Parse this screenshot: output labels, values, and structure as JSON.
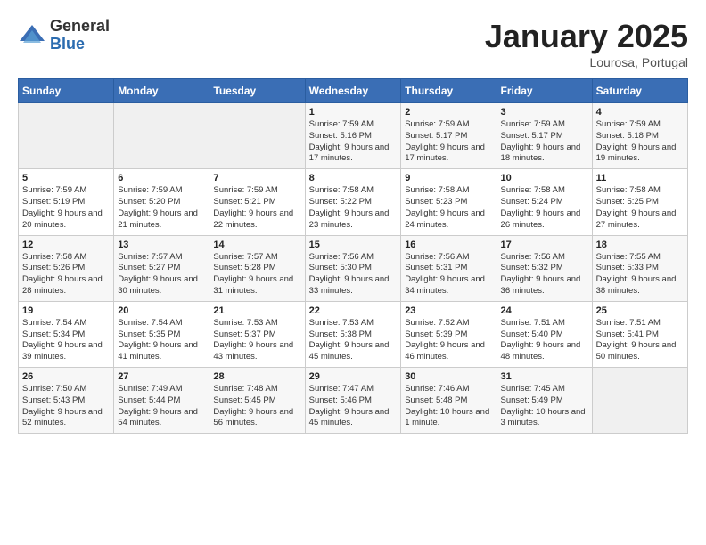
{
  "logo": {
    "general": "General",
    "blue": "Blue"
  },
  "header": {
    "month": "January 2025",
    "location": "Lourosa, Portugal"
  },
  "weekdays": [
    "Sunday",
    "Monday",
    "Tuesday",
    "Wednesday",
    "Thursday",
    "Friday",
    "Saturday"
  ],
  "weeks": [
    [
      {
        "day": "",
        "sunrise": "",
        "sunset": "",
        "daylight": ""
      },
      {
        "day": "",
        "sunrise": "",
        "sunset": "",
        "daylight": ""
      },
      {
        "day": "",
        "sunrise": "",
        "sunset": "",
        "daylight": ""
      },
      {
        "day": "1",
        "sunrise": "Sunrise: 7:59 AM",
        "sunset": "Sunset: 5:16 PM",
        "daylight": "Daylight: 9 hours and 17 minutes."
      },
      {
        "day": "2",
        "sunrise": "Sunrise: 7:59 AM",
        "sunset": "Sunset: 5:17 PM",
        "daylight": "Daylight: 9 hours and 17 minutes."
      },
      {
        "day": "3",
        "sunrise": "Sunrise: 7:59 AM",
        "sunset": "Sunset: 5:17 PM",
        "daylight": "Daylight: 9 hours and 18 minutes."
      },
      {
        "day": "4",
        "sunrise": "Sunrise: 7:59 AM",
        "sunset": "Sunset: 5:18 PM",
        "daylight": "Daylight: 9 hours and 19 minutes."
      }
    ],
    [
      {
        "day": "5",
        "sunrise": "Sunrise: 7:59 AM",
        "sunset": "Sunset: 5:19 PM",
        "daylight": "Daylight: 9 hours and 20 minutes."
      },
      {
        "day": "6",
        "sunrise": "Sunrise: 7:59 AM",
        "sunset": "Sunset: 5:20 PM",
        "daylight": "Daylight: 9 hours and 21 minutes."
      },
      {
        "day": "7",
        "sunrise": "Sunrise: 7:59 AM",
        "sunset": "Sunset: 5:21 PM",
        "daylight": "Daylight: 9 hours and 22 minutes."
      },
      {
        "day": "8",
        "sunrise": "Sunrise: 7:58 AM",
        "sunset": "Sunset: 5:22 PM",
        "daylight": "Daylight: 9 hours and 23 minutes."
      },
      {
        "day": "9",
        "sunrise": "Sunrise: 7:58 AM",
        "sunset": "Sunset: 5:23 PM",
        "daylight": "Daylight: 9 hours and 24 minutes."
      },
      {
        "day": "10",
        "sunrise": "Sunrise: 7:58 AM",
        "sunset": "Sunset: 5:24 PM",
        "daylight": "Daylight: 9 hours and 26 minutes."
      },
      {
        "day": "11",
        "sunrise": "Sunrise: 7:58 AM",
        "sunset": "Sunset: 5:25 PM",
        "daylight": "Daylight: 9 hours and 27 minutes."
      }
    ],
    [
      {
        "day": "12",
        "sunrise": "Sunrise: 7:58 AM",
        "sunset": "Sunset: 5:26 PM",
        "daylight": "Daylight: 9 hours and 28 minutes."
      },
      {
        "day": "13",
        "sunrise": "Sunrise: 7:57 AM",
        "sunset": "Sunset: 5:27 PM",
        "daylight": "Daylight: 9 hours and 30 minutes."
      },
      {
        "day": "14",
        "sunrise": "Sunrise: 7:57 AM",
        "sunset": "Sunset: 5:28 PM",
        "daylight": "Daylight: 9 hours and 31 minutes."
      },
      {
        "day": "15",
        "sunrise": "Sunrise: 7:56 AM",
        "sunset": "Sunset: 5:30 PM",
        "daylight": "Daylight: 9 hours and 33 minutes."
      },
      {
        "day": "16",
        "sunrise": "Sunrise: 7:56 AM",
        "sunset": "Sunset: 5:31 PM",
        "daylight": "Daylight: 9 hours and 34 minutes."
      },
      {
        "day": "17",
        "sunrise": "Sunrise: 7:56 AM",
        "sunset": "Sunset: 5:32 PM",
        "daylight": "Daylight: 9 hours and 36 minutes."
      },
      {
        "day": "18",
        "sunrise": "Sunrise: 7:55 AM",
        "sunset": "Sunset: 5:33 PM",
        "daylight": "Daylight: 9 hours and 38 minutes."
      }
    ],
    [
      {
        "day": "19",
        "sunrise": "Sunrise: 7:54 AM",
        "sunset": "Sunset: 5:34 PM",
        "daylight": "Daylight: 9 hours and 39 minutes."
      },
      {
        "day": "20",
        "sunrise": "Sunrise: 7:54 AM",
        "sunset": "Sunset: 5:35 PM",
        "daylight": "Daylight: 9 hours and 41 minutes."
      },
      {
        "day": "21",
        "sunrise": "Sunrise: 7:53 AM",
        "sunset": "Sunset: 5:37 PM",
        "daylight": "Daylight: 9 hours and 43 minutes."
      },
      {
        "day": "22",
        "sunrise": "Sunrise: 7:53 AM",
        "sunset": "Sunset: 5:38 PM",
        "daylight": "Daylight: 9 hours and 45 minutes."
      },
      {
        "day": "23",
        "sunrise": "Sunrise: 7:52 AM",
        "sunset": "Sunset: 5:39 PM",
        "daylight": "Daylight: 9 hours and 46 minutes."
      },
      {
        "day": "24",
        "sunrise": "Sunrise: 7:51 AM",
        "sunset": "Sunset: 5:40 PM",
        "daylight": "Daylight: 9 hours and 48 minutes."
      },
      {
        "day": "25",
        "sunrise": "Sunrise: 7:51 AM",
        "sunset": "Sunset: 5:41 PM",
        "daylight": "Daylight: 9 hours and 50 minutes."
      }
    ],
    [
      {
        "day": "26",
        "sunrise": "Sunrise: 7:50 AM",
        "sunset": "Sunset: 5:43 PM",
        "daylight": "Daylight: 9 hours and 52 minutes."
      },
      {
        "day": "27",
        "sunrise": "Sunrise: 7:49 AM",
        "sunset": "Sunset: 5:44 PM",
        "daylight": "Daylight: 9 hours and 54 minutes."
      },
      {
        "day": "28",
        "sunrise": "Sunrise: 7:48 AM",
        "sunset": "Sunset: 5:45 PM",
        "daylight": "Daylight: 9 hours and 56 minutes."
      },
      {
        "day": "29",
        "sunrise": "Sunrise: 7:47 AM",
        "sunset": "Sunset: 5:46 PM",
        "daylight": "Daylight: 9 hours and 45 minutes."
      },
      {
        "day": "30",
        "sunrise": "Sunrise: 7:46 AM",
        "sunset": "Sunset: 5:48 PM",
        "daylight": "Daylight: 10 hours and 1 minute."
      },
      {
        "day": "31",
        "sunrise": "Sunrise: 7:45 AM",
        "sunset": "Sunset: 5:49 PM",
        "daylight": "Daylight: 10 hours and 3 minutes."
      },
      {
        "day": "",
        "sunrise": "",
        "sunset": "",
        "daylight": ""
      }
    ]
  ]
}
